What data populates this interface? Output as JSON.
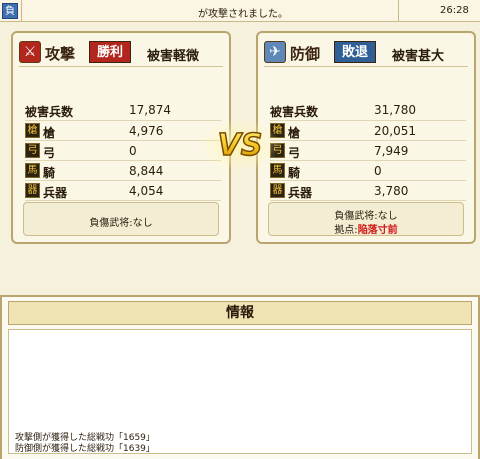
{
  "topbar": {
    "tag": "負",
    "message": "が攻撃されました。",
    "time": "26:28"
  },
  "vs_text": "VS",
  "attacker": {
    "emblem_icon": "crossed-swords-icon",
    "emblem_glyph": "⚔",
    "label": "攻撃",
    "result": "勝利",
    "damage_level": "被害軽微",
    "total_label": "被害兵数",
    "total": "17,874",
    "units": [
      {
        "icon": "spear-icon",
        "glyph": "槍",
        "label": "槍",
        "value": "4,976"
      },
      {
        "icon": "bow-icon",
        "glyph": "弓",
        "label": "弓",
        "value": "0"
      },
      {
        "icon": "horse-icon",
        "glyph": "馬",
        "label": "騎",
        "value": "8,844"
      },
      {
        "icon": "weapon-icon",
        "glyph": "器",
        "label": "兵器",
        "value": "4,054"
      }
    ],
    "injured_general": "負傷武将:なし"
  },
  "defender": {
    "emblem_icon": "defense-icon",
    "emblem_glyph": "✈",
    "label": "防御",
    "result": "敗退",
    "damage_level": "被害甚大",
    "total_label": "被害兵数",
    "total": "31,780",
    "units": [
      {
        "icon": "spear-icon",
        "glyph": "槍",
        "label": "槍",
        "value": "20,051"
      },
      {
        "icon": "bow-icon",
        "glyph": "弓",
        "label": "弓",
        "value": "7,949"
      },
      {
        "icon": "horse-icon",
        "glyph": "馬",
        "label": "騎",
        "value": "0"
      },
      {
        "icon": "weapon-icon",
        "glyph": "器",
        "label": "兵器",
        "value": "3,780"
      }
    ],
    "injured_general": "負傷武将:なし",
    "base_label": "拠点:",
    "base_status": "陥落寸前"
  },
  "info": {
    "title": "情報",
    "log": [
      "攻撃側が獲得した総戦功「1659」",
      "防御側が獲得した総戦功「1639」"
    ]
  },
  "colors": {
    "win": "#b3261e",
    "lose": "#2f5f95",
    "alert": "#d01818",
    "vs_gold": "#f2c21a"
  }
}
